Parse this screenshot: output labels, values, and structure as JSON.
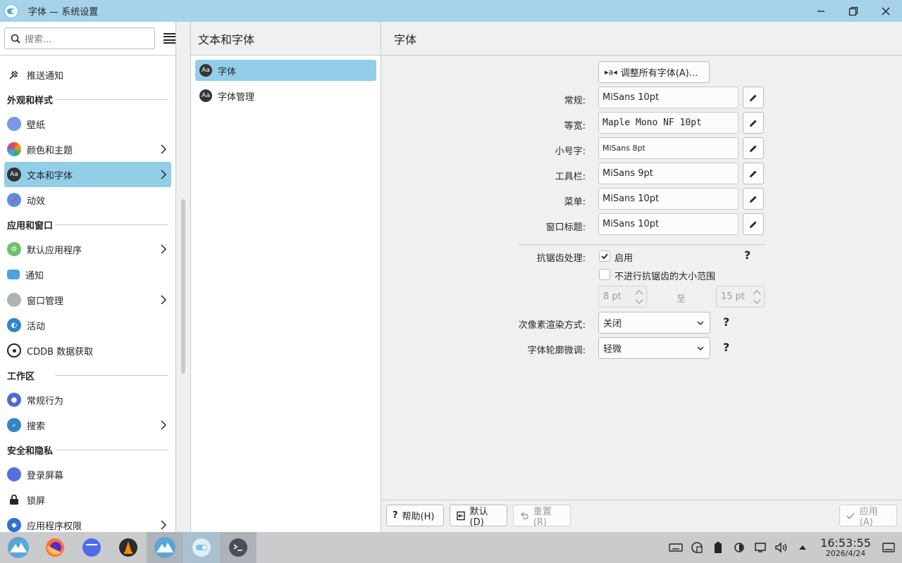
{
  "window": {
    "title": "字体 — 系统设置"
  },
  "sidebar": {
    "search_placeholder": "搜索...",
    "items": [
      {
        "type": "item",
        "label": "推送通知",
        "icon": "push-notification-icon"
      },
      {
        "type": "header",
        "label": "外观和样式"
      },
      {
        "type": "item",
        "label": "壁纸",
        "icon": "wallpaper-icon"
      },
      {
        "type": "item",
        "label": "颜色和主题",
        "icon": "colors-icon",
        "chevron": true
      },
      {
        "type": "item",
        "label": "文本和字体",
        "icon": "fonts-icon",
        "chevron": true,
        "active": true
      },
      {
        "type": "item",
        "label": "动效",
        "icon": "animation-icon"
      },
      {
        "type": "header",
        "label": "应用和窗口"
      },
      {
        "type": "item",
        "label": "默认应用程序",
        "icon": "default-apps-icon",
        "chevron": true
      },
      {
        "type": "item",
        "label": "通知",
        "icon": "notifications-icon"
      },
      {
        "type": "item",
        "label": "窗口管理",
        "icon": "window-management-icon",
        "chevron": true
      },
      {
        "type": "item",
        "label": "活动",
        "icon": "activities-icon"
      },
      {
        "type": "item",
        "label": "CDDB 数据获取",
        "icon": "cddb-icon"
      },
      {
        "type": "header",
        "label": "工作区"
      },
      {
        "type": "item",
        "label": "常规行为",
        "icon": "general-behavior-icon"
      },
      {
        "type": "item",
        "label": "搜索",
        "icon": "search-settings-icon",
        "chevron": true
      },
      {
        "type": "header",
        "label": "安全和隐私"
      },
      {
        "type": "item",
        "label": "登录屏幕",
        "icon": "login-screen-icon"
      },
      {
        "type": "item",
        "label": "锁屏",
        "icon": "lock-icon"
      },
      {
        "type": "item",
        "label": "应用程序权限",
        "icon": "app-permissions-icon",
        "chevron": true
      }
    ]
  },
  "middle": {
    "title": "文本和字体",
    "items": [
      {
        "label": "字体",
        "active": true
      },
      {
        "label": "字体管理",
        "active": false
      }
    ]
  },
  "main": {
    "title": "字体",
    "adjust_all_label": "调整所有字体(A)...",
    "fonts": [
      {
        "label": "常规:",
        "value": "MiSans 10pt",
        "style": "normal"
      },
      {
        "label": "等宽:",
        "value": "Maple Mono NF 10pt",
        "style": "mono"
      },
      {
        "label": "小号字:",
        "value": "MiSans 8pt",
        "style": "small"
      },
      {
        "label": "工具栏:",
        "value": "MiSans 9pt",
        "style": "normal"
      },
      {
        "label": "菜单:",
        "value": "MiSans 10pt",
        "style": "normal"
      },
      {
        "label": "窗口标题:",
        "value": "MiSans 10pt",
        "style": "normal"
      }
    ],
    "antialias": {
      "label": "抗锯齿处理:",
      "enable_label": "启用",
      "enabled": true,
      "exclude_label": "不进行抗锯齿的大小范围",
      "exclude_checked": false,
      "from": "8 pt",
      "to_label": "至",
      "to": "15 pt"
    },
    "subpixel": {
      "label": "次像素渲染方式:",
      "value": "关闭"
    },
    "hinting": {
      "label": "字体轮廓微调:",
      "value": "轻微"
    },
    "help_mark": "?",
    "footer": {
      "help": "帮助(H)",
      "defaults": "默认(D)",
      "reset": "重置(R)",
      "apply": "应用(A)"
    }
  },
  "taskbar": {
    "apps": [
      "kde-launcher-icon",
      "firefox-icon",
      "files-icon",
      "vlc-icon",
      "kde-launcher-icon",
      "system-settings-icon",
      "terminal-icon"
    ],
    "time": "16:53:55",
    "date": "2026/4/24"
  },
  "colors": {
    "accent": "#93cee9",
    "titlebar": "#a6d2ea",
    "taskbar": "#c9cbcd"
  }
}
